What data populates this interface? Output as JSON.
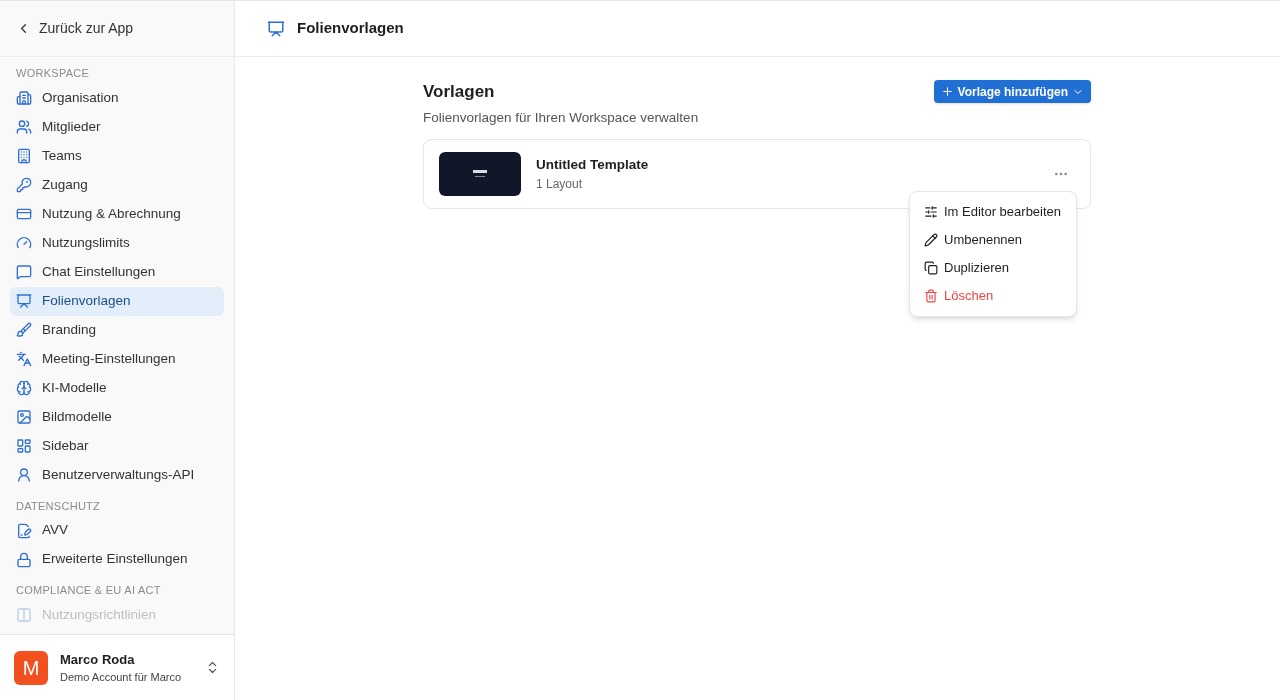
{
  "sidebar": {
    "back_link": "Zurück zur App",
    "sections": [
      {
        "title": "WORKSPACE",
        "items": [
          {
            "label": "Organisation",
            "selected": false
          },
          {
            "label": "Mitglieder",
            "selected": false
          },
          {
            "label": "Teams",
            "selected": false
          },
          {
            "label": "Zugang",
            "selected": false
          },
          {
            "label": "Nutzung & Abrechnung",
            "selected": false
          },
          {
            "label": "Nutzungslimits",
            "selected": false
          },
          {
            "label": "Chat Einstellungen",
            "selected": false
          },
          {
            "label": "Folienvorlagen",
            "selected": true
          },
          {
            "label": "Branding",
            "selected": false
          },
          {
            "label": "Meeting-Einstellungen",
            "selected": false
          },
          {
            "label": "KI-Modelle",
            "selected": false
          },
          {
            "label": "Bildmodelle",
            "selected": false
          },
          {
            "label": "Sidebar",
            "selected": false
          },
          {
            "label": "Benutzerverwaltungs-API",
            "selected": false
          }
        ]
      },
      {
        "title": "DATENSCHUTZ",
        "items": [
          {
            "label": "AVV",
            "selected": false
          },
          {
            "label": "Erweiterte Einstellungen",
            "selected": false
          }
        ]
      },
      {
        "title": "COMPLIANCE & EU AI ACT",
        "items": [
          {
            "label": "Nutzungsrichtlinien",
            "selected": false,
            "disabled": true
          }
        ]
      }
    ],
    "user": {
      "initial": "M",
      "name": "Marco Roda",
      "account": "Demo Account für Marco"
    }
  },
  "header": {
    "title": "Folienvorlagen"
  },
  "main": {
    "title": "Vorlagen",
    "subtitle": "Folienvorlagen für Ihren Workspace verwalten",
    "add_button": "Vorlage hinzufügen",
    "templates": [
      {
        "name": "Untitled Template",
        "meta": "1 Layout"
      }
    ],
    "menu": [
      {
        "label": "Im Editor bearbeiten",
        "kind": "normal"
      },
      {
        "label": "Umbenennen",
        "kind": "normal"
      },
      {
        "label": "Duplizieren",
        "kind": "normal"
      },
      {
        "label": "Löschen",
        "kind": "danger"
      }
    ]
  }
}
